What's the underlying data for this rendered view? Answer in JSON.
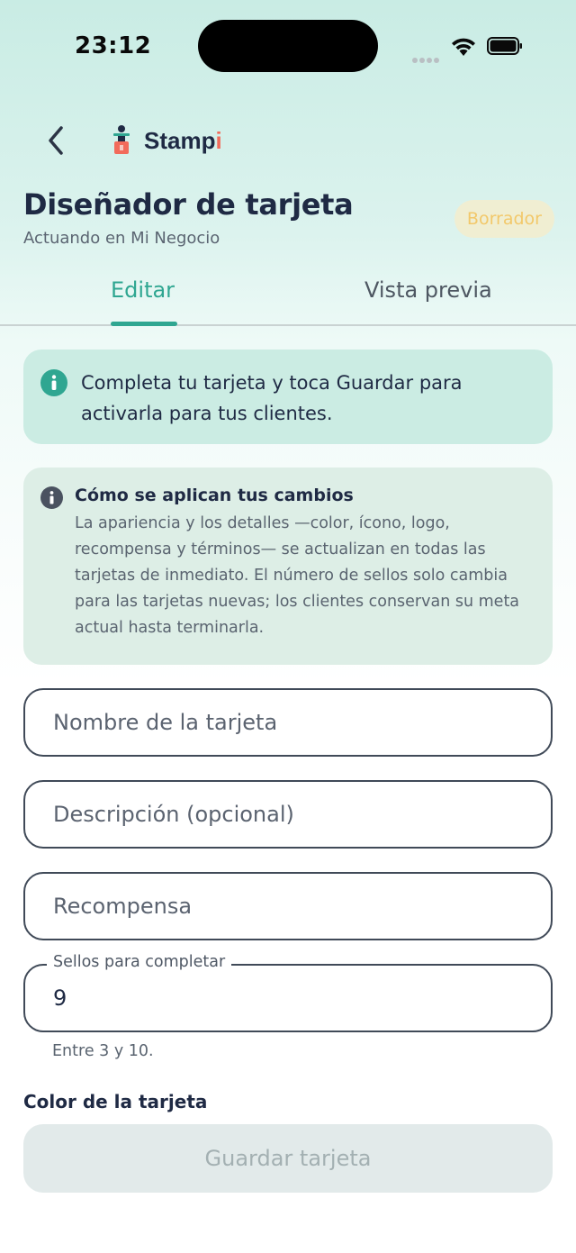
{
  "status_bar": {
    "time": "23:12"
  },
  "brand": {
    "name_main": "Stamp",
    "name_accent": "i"
  },
  "header": {
    "title": "Diseñador de tarjeta",
    "subtitle": "Actuando en Mi Negocio",
    "badge": "Borrador"
  },
  "tabs": [
    {
      "label": "Editar",
      "active": true
    },
    {
      "label": "Vista previa",
      "active": false
    }
  ],
  "info_banner": {
    "icon": "info-icon",
    "text": "Completa tu tarjeta y toca Guardar para activarla para tus clientes."
  },
  "changes_notice": {
    "icon": "info-icon",
    "title": "Cómo se aplican tus cambios",
    "body": "La apariencia y los detalles —color, ícono, logo, recompensa y términos— se actualizan en todas las tarjetas de inmediato. El número de sellos solo cambia para las tarjetas nuevas; los clientes conservan su meta actual hasta terminarla."
  },
  "form": {
    "name_placeholder": "Nombre de la tarjeta",
    "description_placeholder": "Descripción (opcional)",
    "reward_placeholder": "Recompensa",
    "stamps_label": "Sellos para completar",
    "stamps_value": "9",
    "stamps_helper": "Entre 3 y 10.",
    "color_label": "Color de la tarjeta"
  },
  "actions": {
    "save_label": "Guardar tarjeta"
  },
  "colors": {
    "accent": "#2fa691",
    "badge_text": "#f2c86a",
    "brand_accent": "#f26b5b"
  }
}
